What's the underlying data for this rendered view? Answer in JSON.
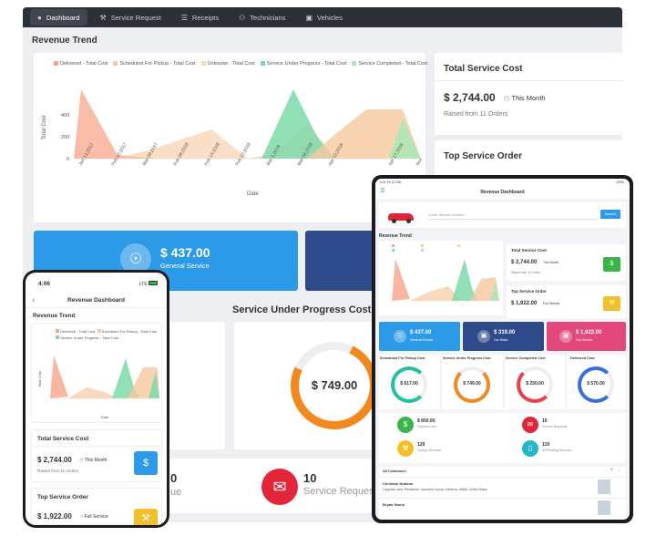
{
  "nav": {
    "items": [
      {
        "label": "Dashboard",
        "icon": "user-icon"
      },
      {
        "label": "Service Request",
        "icon": "wrench-icon"
      },
      {
        "label": "Receipts",
        "icon": "receipt-icon"
      },
      {
        "label": "Technicians",
        "icon": "technician-icon"
      },
      {
        "label": "Vehicles",
        "icon": "car-icon"
      }
    ]
  },
  "desktop": {
    "revenue_title": "Revenue Trend",
    "legend": [
      "Delivered - Total Cost",
      "Scheduled For Pickup - Total Cost",
      "Unknown - Total Cost",
      "Service Under Progress - Total Cost",
      "Service Completed - Total Cost"
    ],
    "ylabel": "Total Cost",
    "xlabel": "Date",
    "yticks": [
      "400",
      "200",
      "0"
    ],
    "xticks": [
      "Jan 13,2017",
      "Feb 02,2017",
      "Mar 09,2017",
      "Feb 09,2018",
      "Feb 14,2018",
      "Feb 22,2018",
      "Mar 1,2018",
      "Mar 06,2018",
      "Apr 10,2018",
      "Apr 17,2018",
      "Nov"
    ],
    "total_service_title": "Total Service Cost",
    "total_service_value": "$ 2,744.00",
    "total_service_period": "This Month",
    "total_service_sub": "Raised from 11 Orders",
    "top_order_title": "Top Service Order",
    "general_value": "$ 437.00",
    "general_label": "General Service",
    "sup_title": "Service Under Progress Cost",
    "sup_value": "$ 749.00",
    "left_number": "0",
    "left_label": "ue",
    "req_number": "10",
    "req_label": "Service Request"
  },
  "phone": {
    "time": "4:06",
    "signal": "LTE",
    "title": "Revenue Dashboard",
    "section": "Revenue Trend",
    "legend": [
      "Delivered - Total Cost",
      "Scheduled For Pickup - Total Cost",
      "Service Under Progress - Total Cost"
    ],
    "ylabel": "Total Cost",
    "xlabel": "Date",
    "total_title": "Total Service Cost",
    "total_value": "$ 2,744.00",
    "total_period": "This Month",
    "total_sub": "Raised from 11 Orders",
    "top_title": "Top Service Order",
    "top_value": "$ 1,922.00",
    "top_label": "Full Service"
  },
  "tablet": {
    "status_time": "9:41 Fri 11 Feb",
    "battery": "100%",
    "title": "Revenue Dashboard",
    "search_placeholder": "Enter Vehicle Number",
    "search_button": "Search",
    "revenue_title": "Revenue Trend",
    "total_title": "Total Service Cost",
    "total_value": "$ 2,744.00",
    "total_period": "This Month",
    "total_sub": "Raised from 11 Orders",
    "top_title": "Top Service Order",
    "top_value": "$ 1,922.00",
    "top_label": "Full Service",
    "tiles": [
      {
        "value": "$ 437.00",
        "label": "General Service",
        "color": "#2d9ae8"
      },
      {
        "value": "$ 319.00",
        "label": "Car Wash",
        "color": "#2f4a8a"
      },
      {
        "value": "$ 1,922.00",
        "label": "Full Service",
        "color": "#e2487a"
      }
    ],
    "gauges": [
      {
        "label": "Scheduled For Pickup Cost",
        "value": "$ 617.00",
        "color": "#26c0a0"
      },
      {
        "label": "Service Under Progress Cost",
        "value": "$ 749.00",
        "color": "#f2891f"
      },
      {
        "label": "Service Completed Cost",
        "value": "$ 250.00",
        "color": "#e9414b"
      },
      {
        "label": "Delivered Cost",
        "value": "$ 570.00",
        "color": "#3a6fd8"
      }
    ],
    "stats": [
      {
        "value": "$ 850.00",
        "label": "Payment Due",
        "color": "#3bb54a"
      },
      {
        "value": "10",
        "label": "Service Requests",
        "color": "#e2263a"
      },
      {
        "value": "129",
        "label": "Today's Services",
        "color": "#f0c02d"
      },
      {
        "value": "119",
        "label": "All Pending Services",
        "color": "#25b7c7"
      }
    ],
    "customers_title": "All Customers",
    "customer1_name": "Christian Hudson",
    "customer1_addr": "Longview Lane, Pleasanton, Alameda County, California, 94566, United States",
    "customer2_name": "Bryan Harris"
  },
  "colors": {
    "delivered": "#f7a58a",
    "scheduled": "#f6c89e",
    "unknown": "#fbd9a8",
    "progress": "#7ed9a8",
    "completed": "#a9e6b6",
    "blue": "#2d9ae8",
    "navy": "#2f4a8a"
  }
}
